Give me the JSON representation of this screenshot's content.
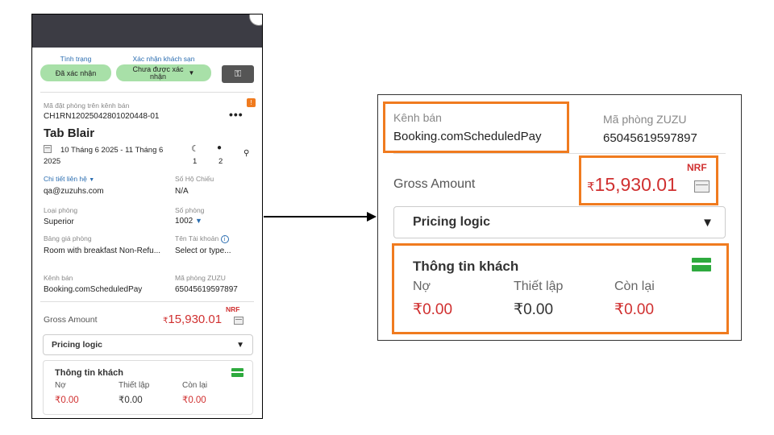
{
  "status": {
    "status_label": "Tình trạng",
    "status_value": "Đã xác nhận",
    "confirm_label": "Xác nhận khách sạn",
    "confirm_value": "Chưa được xác nhận",
    "confirm_value_line1": "Chưa được xác",
    "confirm_value_line2": "nhận"
  },
  "booking": {
    "channel_code_label": "Mã đặt phòng trên kênh bán",
    "channel_code": "CH1RN12025042801020448-01",
    "badge": "!",
    "more": "•••",
    "guest_name": "Tab Blair",
    "date_line1": "10 Tháng 6 2025 - 11 Tháng 6",
    "date_line2": "2025",
    "nights": "1",
    "guests": "2"
  },
  "details": {
    "contact_label": "Chi tiết liên hệ",
    "contact_value": "qa@zuzuhs.com",
    "passport_label": "Số Hộ Chiếu",
    "passport_value": "N/A",
    "room_type_label": "Loại phòng",
    "room_type_value": "Superior",
    "room_no_label": "Số phòng",
    "room_no_value": "1002",
    "rate_label": "Bảng giá phòng",
    "rate_value": "Room with breakfast Non-Refu...",
    "account_label": "Tên Tài khoản",
    "account_value": "Select or type...",
    "channel_label": "Kênh bán",
    "channel_value": "Booking.comScheduledPay",
    "zuzu_label": "Mã phòng ZUZU",
    "zuzu_value": "65045619597897"
  },
  "pricing": {
    "gross_label": "Gross Amount",
    "nrf": "NRF",
    "currency": "₹",
    "gross_value": "15,930.01",
    "logic_label": "Pricing logic",
    "caret": "▼"
  },
  "guest_info": {
    "title": "Thông tin khách",
    "owed_label": "Nợ",
    "setup_label": "Thiết lập",
    "remaining_label": "Còn lại",
    "owed_value": "₹0.00",
    "setup_value": "₹0.00",
    "remaining_value": "₹0.00"
  },
  "colors": {
    "accent": "#f07b1f",
    "green_pill": "#a8e0a8",
    "link_blue": "#2a6db0",
    "amount_red": "#d03030",
    "header_dark": "#3c3c44"
  }
}
